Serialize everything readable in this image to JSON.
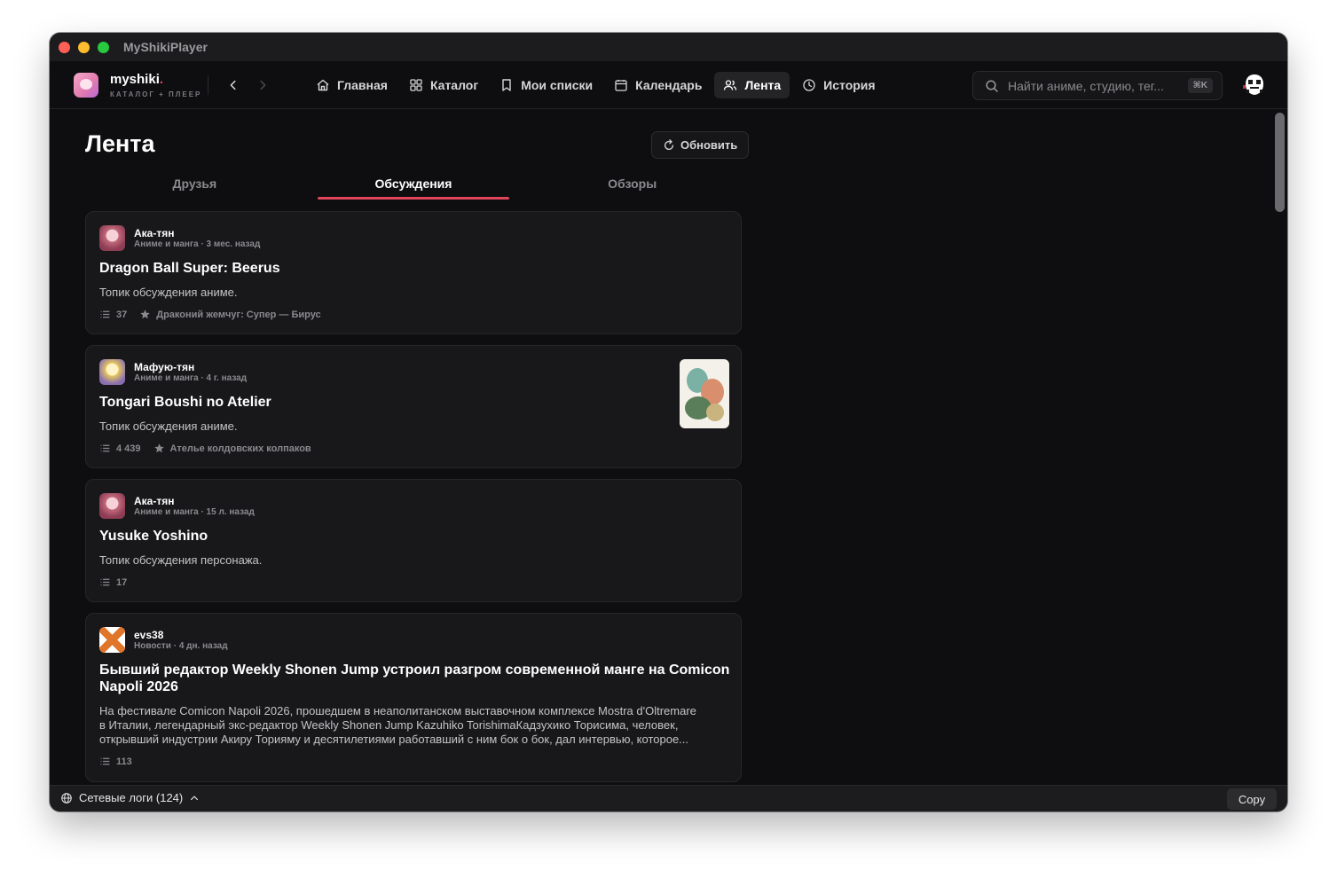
{
  "window": {
    "title": "MyShikiPlayer"
  },
  "brand": {
    "name": "myshiki",
    "name_dot": ".",
    "tagline": "КАТАЛОГ + ПЛЕЕР"
  },
  "nav": {
    "items": [
      {
        "label": "Главная",
        "icon": "home-icon"
      },
      {
        "label": "Каталог",
        "icon": "grid-icon"
      },
      {
        "label": "Мои списки",
        "icon": "bookmark-icon"
      },
      {
        "label": "Календарь",
        "icon": "calendar-icon"
      },
      {
        "label": "Лента",
        "icon": "users-icon",
        "active": true
      },
      {
        "label": "История",
        "icon": "clock-icon"
      }
    ]
  },
  "search": {
    "placeholder": "Найти аниме, студию, тег...",
    "shortcut": "⌘K"
  },
  "page": {
    "title": "Лента",
    "refresh_label": "Обновить",
    "tabs": [
      {
        "label": "Друзья"
      },
      {
        "label": "Обсуждения",
        "active": true
      },
      {
        "label": "Обзоры"
      }
    ]
  },
  "feed": [
    {
      "author": "Ака-тян",
      "meta": "Аниме и манга · 3 мес. назад",
      "title": "Dragon Ball Super: Beerus",
      "description": "Топик обсуждения аниме.",
      "comments": "37",
      "linked": "Драконий жемчуг: Супер — Бирус"
    },
    {
      "author": "Мафую-тян",
      "meta": "Аниме и манга · 4 г. назад",
      "title": "Tongari Boushi no Atelier",
      "description": "Топик обсуждения аниме.",
      "comments": "4 439",
      "linked": "Ателье колдовских колпаков"
    },
    {
      "author": "Ака-тян",
      "meta": "Аниме и манга · 15 л. назад",
      "title": "Yusuke Yoshino",
      "description": "Топик обсуждения персонажа.",
      "comments": "17"
    },
    {
      "author": "evs38",
      "meta": "Новости · 4 дн. назад",
      "title_line1": "Бывший редактор Weekly Shonen Jump устроил разгром современной манге на Comicon",
      "title_line2": "Napoli 2026",
      "desc_line1": "На фестивале Comicon Napoli 2026, прошедшем в неаполитанском выставочном комплексе Mostra d'Oltremare",
      "desc_line2": "в Италии, легендарный экс-редактор Weekly Shonen Jump Kazuhiko TorishimaКадзухико Торисима, человек,",
      "desc_line3": "открывший индустрии Акиру Торияму и десятилетиями работавший с ним бок о бок, дал интервью, которое...",
      "comments": "113"
    }
  ],
  "bottombar": {
    "logs_label": "Сетевые логи (124)",
    "copy_label": "Copy"
  },
  "colors": {
    "accent": "#e0455b",
    "background": "#0e0e10",
    "card": "#18181b"
  }
}
